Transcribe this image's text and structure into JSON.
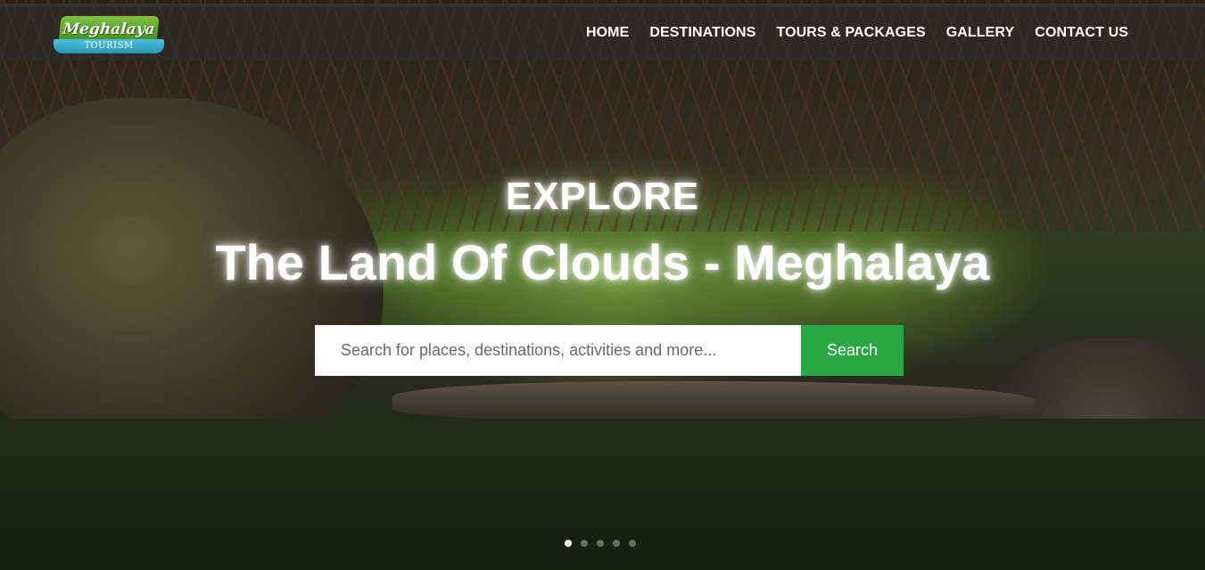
{
  "logo": {
    "main_text": "Meghalaya",
    "sub_text": "TOURISM",
    "colors": {
      "main": "#5aa632",
      "sub": "#3aaccc"
    }
  },
  "nav": {
    "items": [
      {
        "label": "HOME"
      },
      {
        "label": "DESTINATIONS"
      },
      {
        "label": "TOURS & PACKAGES"
      },
      {
        "label": "GALLERY"
      },
      {
        "label": "CONTACT US"
      }
    ]
  },
  "hero": {
    "explore": "EXPLORE",
    "tagline": "The Land Of Clouds - Meghalaya",
    "background": "living root bridge over forest stream"
  },
  "search": {
    "placeholder": "Search for places, destinations, activities and more...",
    "value": "",
    "button_label": "Search",
    "button_color": "#28a745"
  },
  "carousel": {
    "slide_count": 5,
    "active_index": 0
  }
}
